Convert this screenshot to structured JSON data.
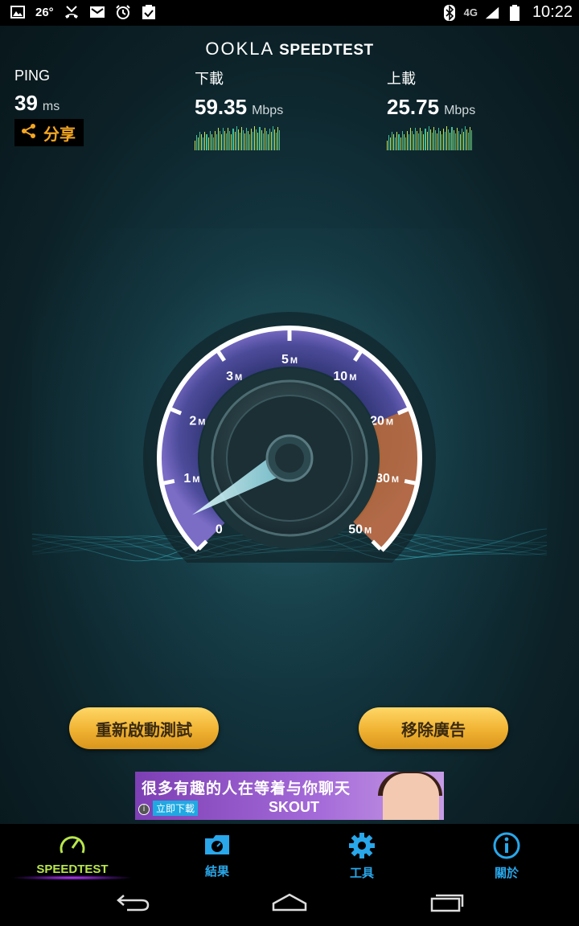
{
  "status_bar": {
    "temperature": "26°",
    "network": "4G",
    "time": "10:22",
    "icons": [
      "gallery-icon",
      "missed-call-icon",
      "email-icon",
      "alarm-icon",
      "clipboard-check-icon",
      "bluetooth-icon",
      "signal-icon",
      "battery-icon"
    ]
  },
  "header": {
    "brand": "OOKLA",
    "product": "SPEEDTEST"
  },
  "metrics": {
    "ping": {
      "label": "PING",
      "value": "39",
      "unit": "ms"
    },
    "download": {
      "label": "下載",
      "value": "59.35",
      "unit": "Mbps"
    },
    "upload": {
      "label": "上載",
      "value": "25.75",
      "unit": "Mbps"
    },
    "share_label": "分享"
  },
  "gauge": {
    "tick_labels": [
      "0",
      "1",
      "2",
      "3",
      "5",
      "10",
      "20",
      "30",
      "50"
    ],
    "tick_units": [
      "",
      "M",
      "M",
      "M",
      "M",
      "M",
      "M",
      "M",
      "M"
    ],
    "needle_value_mbps": 0.2,
    "highlight_from_mbps": 20,
    "highlight_to_mbps": 50
  },
  "actions": {
    "restart": "重新啟動測試",
    "remove_ads": "移除廣告"
  },
  "ad": {
    "headline": "很多有趣的人在等着与你聊天",
    "download_label": "立即下載",
    "brand": "SKOUT"
  },
  "nav": {
    "speedtest": "SPEEDTEST",
    "results": "結果",
    "tools": "工具",
    "about": "關於"
  },
  "colors": {
    "accent_orange": "#f4a623",
    "nav_active": "#b8e64b",
    "nav_blue": "#29a7ea",
    "gauge_purple": "#5a4a9e",
    "gauge_orange": "#c8743a"
  }
}
